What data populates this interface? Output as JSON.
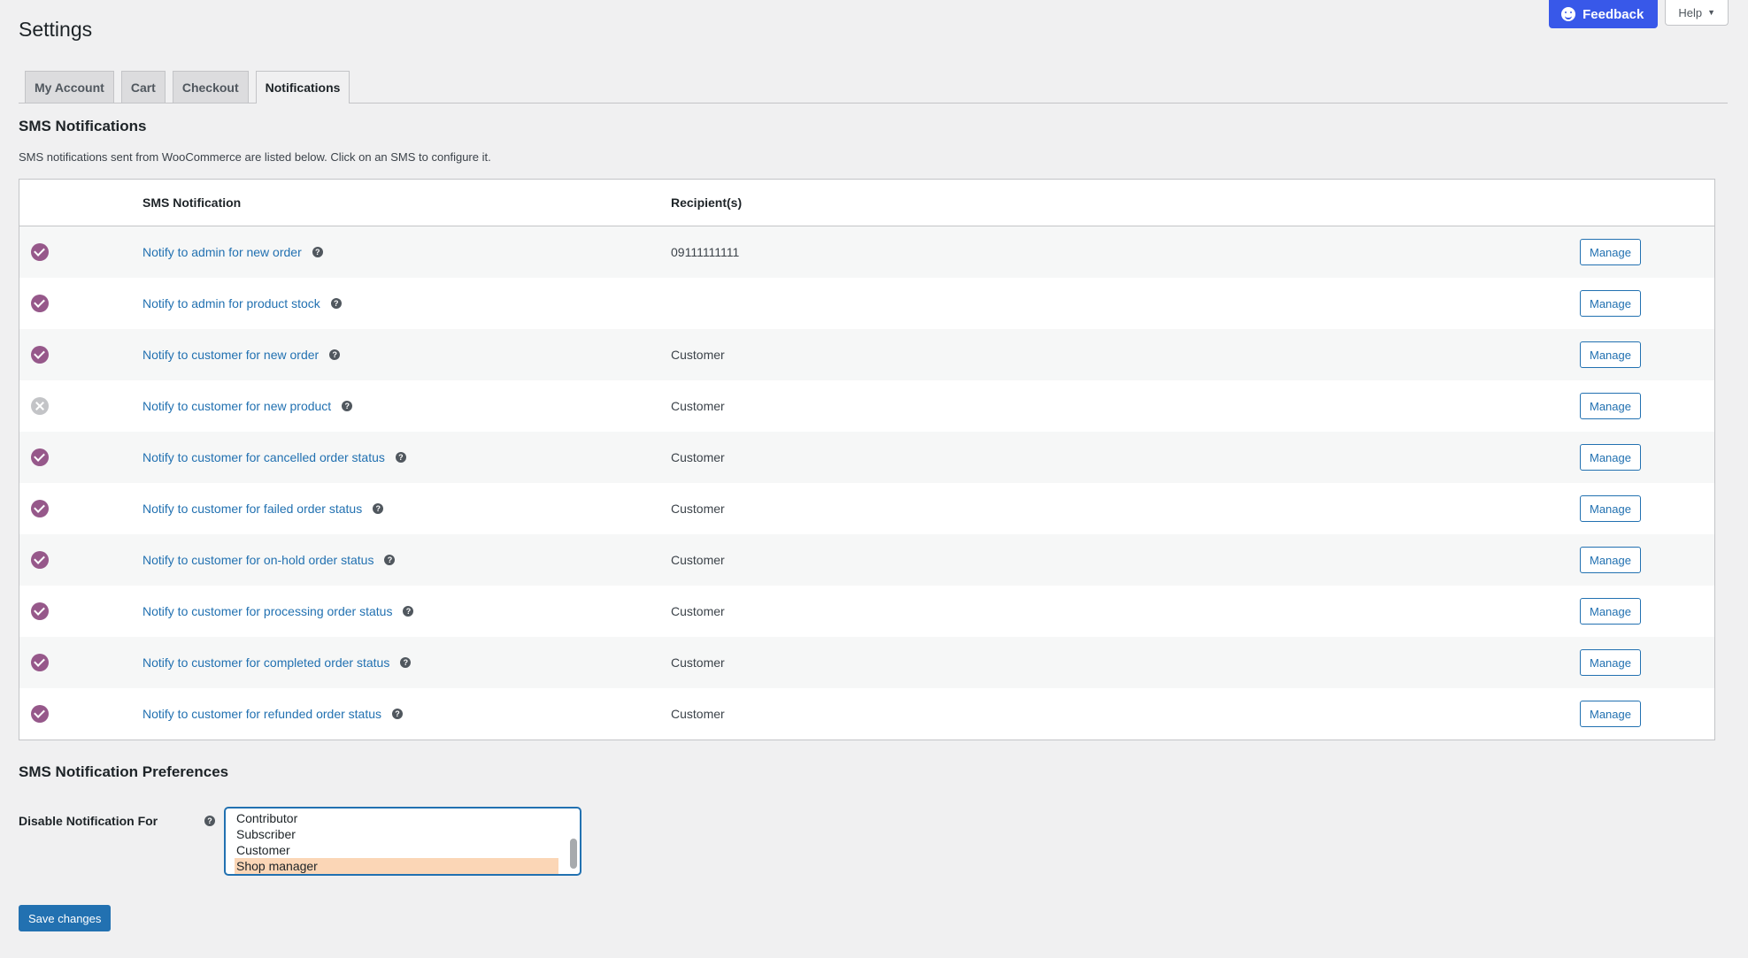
{
  "header": {
    "feedback_label": "Feedback",
    "help_label": "Help"
  },
  "page_title": "Settings",
  "tabs": [
    {
      "label": "My Account",
      "active": false
    },
    {
      "label": "Cart",
      "active": false
    },
    {
      "label": "Checkout",
      "active": false
    },
    {
      "label": "Notifications",
      "active": true
    }
  ],
  "sms": {
    "title": "SMS Notifications",
    "description": "SMS notifications sent from WooCommerce are listed below. Click on an SMS to configure it.",
    "columns": {
      "notification": "SMS Notification",
      "recipients": "Recipient(s)"
    },
    "rows": [
      {
        "enabled": true,
        "name": "Notify to admin for new order",
        "recipient": "09111111111",
        "action": "Manage"
      },
      {
        "enabled": true,
        "name": "Notify to admin for product stock",
        "recipient": "",
        "action": "Manage"
      },
      {
        "enabled": true,
        "name": "Notify to customer for new order",
        "recipient": "Customer",
        "action": "Manage"
      },
      {
        "enabled": false,
        "name": "Notify to customer for new product",
        "recipient": "Customer",
        "action": "Manage"
      },
      {
        "enabled": true,
        "name": "Notify to customer for cancelled order status",
        "recipient": "Customer",
        "action": "Manage"
      },
      {
        "enabled": true,
        "name": "Notify to customer for failed order status",
        "recipient": "Customer",
        "action": "Manage"
      },
      {
        "enabled": true,
        "name": "Notify to customer for on-hold order status",
        "recipient": "Customer",
        "action": "Manage"
      },
      {
        "enabled": true,
        "name": "Notify to customer for processing order status",
        "recipient": "Customer",
        "action": "Manage"
      },
      {
        "enabled": true,
        "name": "Notify to customer for completed order status",
        "recipient": "Customer",
        "action": "Manage"
      },
      {
        "enabled": true,
        "name": "Notify to customer for refunded order status",
        "recipient": "Customer",
        "action": "Manage"
      }
    ]
  },
  "preferences": {
    "title": "SMS Notification Preferences",
    "disable_label": "Disable Notification For",
    "role_options": [
      "Contributor",
      "Subscriber",
      "Customer",
      "Shop manager"
    ],
    "selected_role": "Shop manager"
  },
  "save_label": "Save changes",
  "colors": {
    "accent": "#2271b1",
    "enabled_status": "#96588a",
    "disabled_status": "#c3c4c7",
    "feedback": "#3858e9"
  }
}
